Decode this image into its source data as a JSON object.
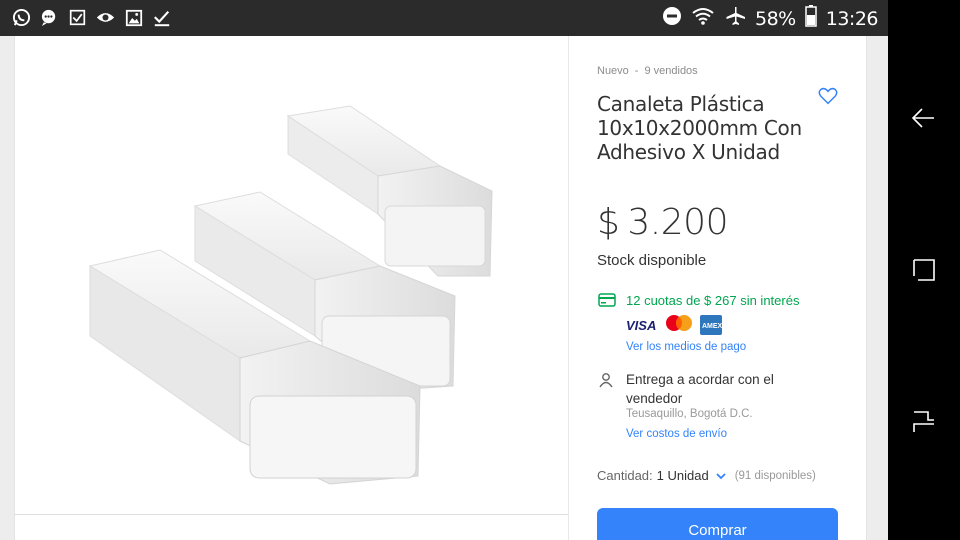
{
  "status_bar": {
    "left_icons": [
      "whatsapp-icon",
      "chat-icon",
      "checkbox-icon",
      "eye-icon",
      "image-icon",
      "check-icon"
    ],
    "battery": "58%",
    "time": "13:26"
  },
  "product": {
    "condition": "Nuevo",
    "sold": "9 vendidos",
    "title": "Canaleta Plástica 10x10x2000mm Con Adhesivo X Unidad",
    "price_currency": "$",
    "price_amount": "3.200",
    "stock": "Stock disponible"
  },
  "payment": {
    "installments": "12 cuotas de $ 267 sin interés",
    "card_brands": [
      "VISA",
      "mastercard",
      "AMEX"
    ],
    "methods_link": "Ver los medios de pago"
  },
  "shipping": {
    "text": "Entrega a acordar con el vendedor",
    "location": "Teusaquillo, Bogotá D.C.",
    "costs_link": "Ver costos de envío"
  },
  "quantity": {
    "label": "Cantidad:",
    "value": "1 Unidad",
    "available": "(91 disponibles)"
  },
  "buy_button": "Comprar",
  "colors": {
    "primary": "#3483fa",
    "green": "#00a650",
    "text": "#333333"
  }
}
